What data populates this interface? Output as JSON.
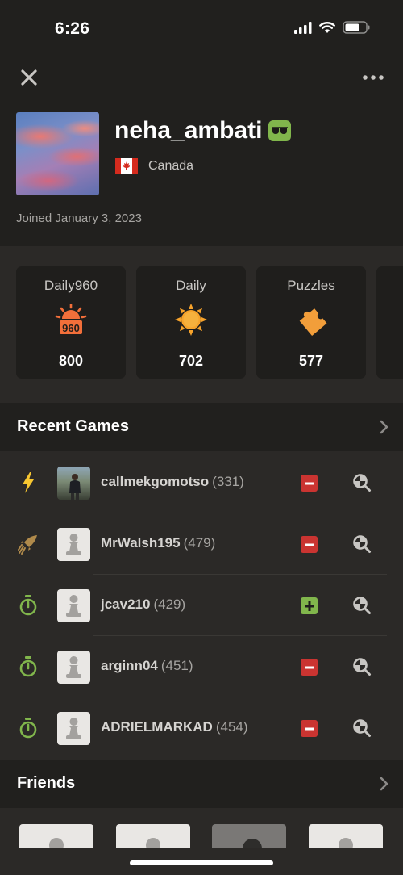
{
  "status_bar": {
    "time": "6:26"
  },
  "profile": {
    "username": "neha_ambati",
    "country": "Canada",
    "joined": "Joined January 3, 2023"
  },
  "ratings": [
    {
      "label": "Daily960",
      "value": "800",
      "icon": "daily960-sun-icon"
    },
    {
      "label": "Daily",
      "value": "702",
      "icon": "sun-icon"
    },
    {
      "label": "Puzzles",
      "value": "577",
      "icon": "puzzle-piece-icon"
    }
  ],
  "recent_games": {
    "title": "Recent Games",
    "games": [
      {
        "mode_icon": "lightning-bolt-icon",
        "opponent": "callmekgomotso",
        "rating": "(331)",
        "result": "loss"
      },
      {
        "mode_icon": "rocket-icon",
        "opponent": "MrWalsh195",
        "rating": "(479)",
        "result": "loss"
      },
      {
        "mode_icon": "stopwatch-icon",
        "opponent": "jcav210",
        "rating": "(429)",
        "result": "win"
      },
      {
        "mode_icon": "stopwatch-icon",
        "opponent": "arginn04",
        "rating": "(451)",
        "result": "loss"
      },
      {
        "mode_icon": "stopwatch-icon",
        "opponent": "ADRIELMARKAD",
        "rating": "(454)",
        "result": "loss"
      }
    ]
  },
  "friends": {
    "title": "Friends"
  },
  "colors": {
    "background": "#2b2927",
    "header": "#21201e",
    "win": "#81b64c",
    "loss": "#ca3431",
    "accent_orange": "#f7a32b"
  }
}
